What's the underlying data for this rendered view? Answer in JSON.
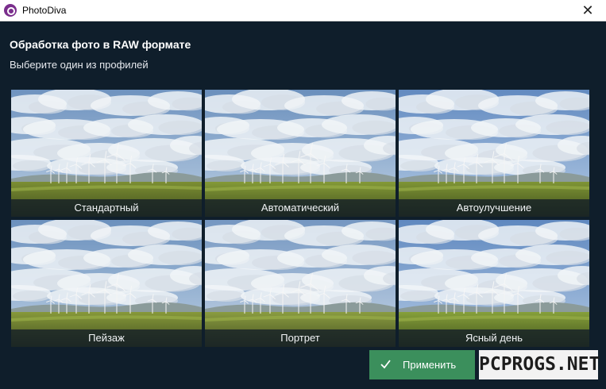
{
  "window": {
    "title": "PhotoDiva",
    "close_glyph": "✕"
  },
  "dialog": {
    "heading": "Обработка фото в RAW формате",
    "subheading": "Выберите один из профилей"
  },
  "profiles": [
    {
      "label": "Стандартный"
    },
    {
      "label": "Автоматический"
    },
    {
      "label": "Автоулучшение"
    },
    {
      "label": "Пейзаж"
    },
    {
      "label": "Портрет"
    },
    {
      "label": "Ясный день"
    }
  ],
  "actions": {
    "apply_label": "Применить"
  },
  "watermark": {
    "text": "PCPROGS.NET"
  },
  "colors": {
    "dialog_background": "#0f1e2b",
    "apply_button": "#3b8f5c"
  },
  "icons": {
    "app": "photodiva-logo-icon",
    "close": "close-icon",
    "apply": "checkmark-icon"
  }
}
